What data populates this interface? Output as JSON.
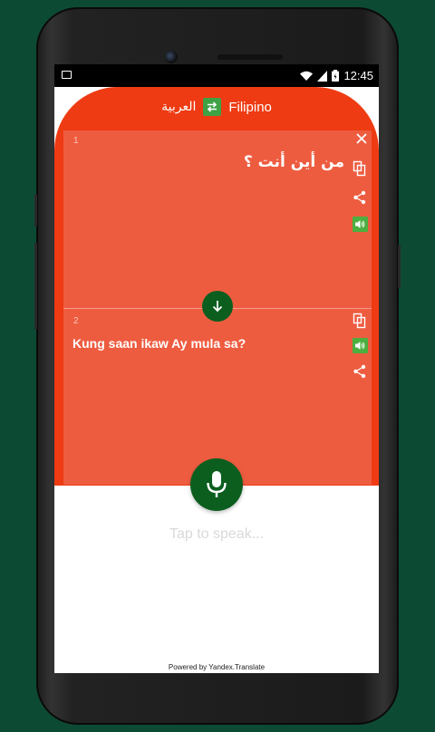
{
  "status_bar": {
    "time": "12:45"
  },
  "language_bar": {
    "source_language": "العربية",
    "target_language": "Filipino"
  },
  "source_panel": {
    "number": "1",
    "text": "من أين أنت ؟"
  },
  "target_panel": {
    "number": "2",
    "text": "Kung saan ikaw Ay mula sa?"
  },
  "speak_hint": "Tap to speak...",
  "footer": "Powered by Yandex.Translate",
  "colors": {
    "background": "#0d4a34",
    "accent_red": "#ee3b13",
    "panel_red": "#ee5c40",
    "dark_green": "#0c5e1e",
    "speaker_green": "#4caf3f"
  }
}
